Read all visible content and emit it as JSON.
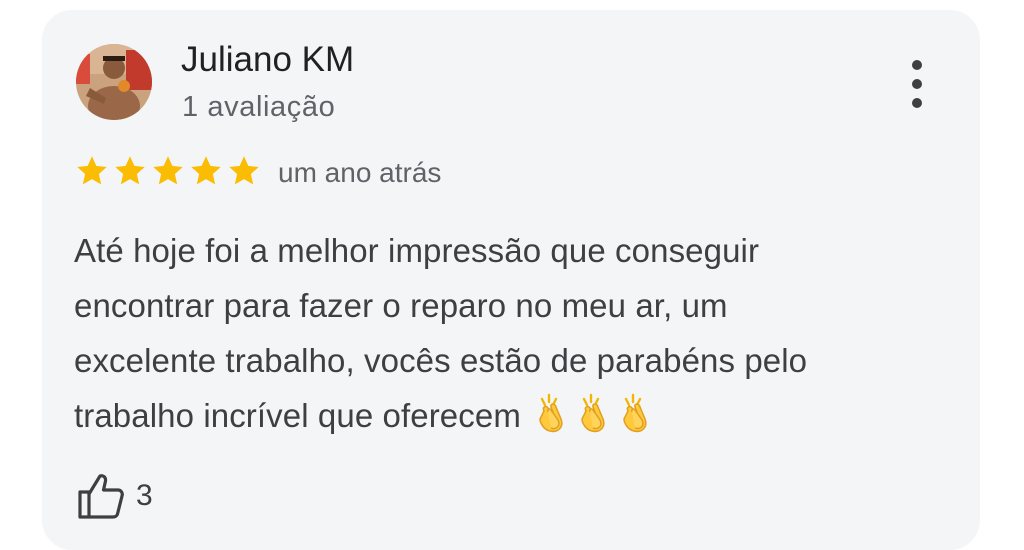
{
  "review": {
    "author_name": "Juliano KM",
    "author_review_count": "1 avaliação",
    "rating": 5,
    "max_rating": 5,
    "date": "um ano atrás",
    "text_lines": [
      "Até hoje foi a melhor impressão que conseguir",
      "encontrar para fazer o reparo no meu ar, um",
      "excelente trabalho, vocês estão de parabéns pelo",
      "trabalho incrível que oferecem"
    ],
    "emojis": [
      "clapping-hands",
      "clapping-hands",
      "clapping-hands"
    ],
    "likes": "3"
  },
  "icons": {
    "more": "more-vert-icon",
    "like": "thumb-up-outline-icon",
    "star": "star-icon"
  },
  "colors": {
    "card_background": "#f4f5f7",
    "star": "#fbbc04",
    "name": "#202124",
    "secondary_text": "#5f6368",
    "body_text": "#3c4043"
  }
}
